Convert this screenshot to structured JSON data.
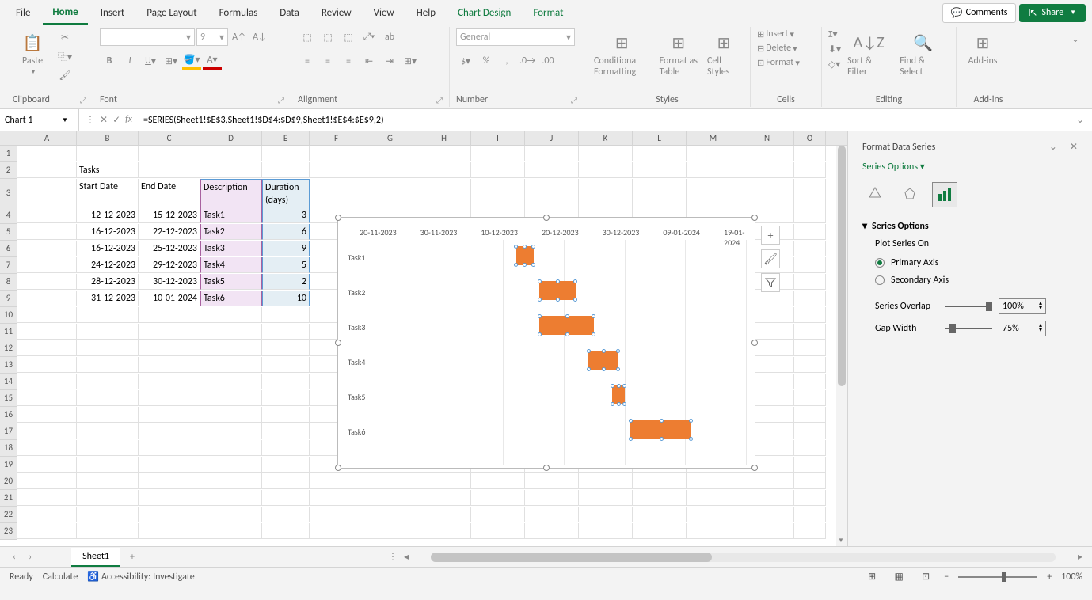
{
  "menu": {
    "items": [
      "File",
      "Home",
      "Insert",
      "Page Layout",
      "Formulas",
      "Data",
      "Review",
      "View",
      "Help",
      "Chart Design",
      "Format"
    ],
    "active": "Home",
    "comments": "Comments",
    "share": "Share"
  },
  "ribbon": {
    "clipboard": {
      "paste": "Paste",
      "label": "Clipboard"
    },
    "font": {
      "size": "9",
      "label": "Font"
    },
    "alignment": {
      "label": "Alignment"
    },
    "number": {
      "format": "General",
      "label": "Number"
    },
    "styles": {
      "conditional": "Conditional Formatting",
      "formatAs": "Format as Table",
      "cellStyles": "Cell Styles",
      "label": "Styles"
    },
    "cells": {
      "insert": "Insert",
      "delete": "Delete",
      "format": "Format",
      "label": "Cells"
    },
    "editing": {
      "sortFilter": "Sort & Filter",
      "findSelect": "Find & Select",
      "label": "Editing"
    },
    "addins": {
      "addins": "Add-ins",
      "label": "Add-ins"
    }
  },
  "nameBox": "Chart 1",
  "formula": "=SERIES(Sheet1!$E$3,Sheet1!$D$4:$D$9,Sheet1!$E$4:$E$9,2)",
  "columns": [
    "A",
    "B",
    "C",
    "D",
    "E",
    "F",
    "G",
    "H",
    "I",
    "J",
    "K",
    "L",
    "M",
    "N",
    "O"
  ],
  "spreadsheet": {
    "b2": "Tasks",
    "headers": {
      "b": "Start Date",
      "c": "End Date",
      "d": "Description",
      "e": "Duration (days)"
    },
    "rows": [
      {
        "start": "12-12-2023",
        "end": "15-12-2023",
        "desc": "Task1",
        "dur": "3"
      },
      {
        "start": "16-12-2023",
        "end": "22-12-2023",
        "desc": "Task2",
        "dur": "6"
      },
      {
        "start": "16-12-2023",
        "end": "25-12-2023",
        "desc": "Task3",
        "dur": "9"
      },
      {
        "start": "24-12-2023",
        "end": "29-12-2023",
        "desc": "Task4",
        "dur": "5"
      },
      {
        "start": "28-12-2023",
        "end": "30-12-2023",
        "desc": "Task5",
        "dur": "2"
      },
      {
        "start": "31-12-2023",
        "end": "10-01-2024",
        "desc": "Task6",
        "dur": "10"
      }
    ]
  },
  "chart_data": {
    "type": "bar",
    "title": "",
    "xlabel": "",
    "ylabel": "",
    "x_ticks": [
      "20-11-2023",
      "30-11-2023",
      "10-12-2023",
      "20-12-2023",
      "30-12-2023",
      "09-01-2024",
      "19-01-2024"
    ],
    "categories": [
      "Task1",
      "Task2",
      "Task3",
      "Task4",
      "Task5",
      "Task6"
    ],
    "series": [
      {
        "name": "Start Date",
        "values": [
          "12-12-2023",
          "16-12-2023",
          "16-12-2023",
          "24-12-2023",
          "28-12-2023",
          "31-12-2023"
        ]
      },
      {
        "name": "Duration (days)",
        "values": [
          3,
          6,
          9,
          5,
          2,
          10
        ]
      }
    ]
  },
  "panel": {
    "title": "Format Data Series",
    "subtitle": "Series Options",
    "section": "Series Options",
    "plotOn": "Plot Series On",
    "primary": "Primary Axis",
    "secondary": "Secondary Axis",
    "overlap": "Series Overlap",
    "overlapVal": "100%",
    "gapWidth": "Gap Width",
    "gapVal": "75%"
  },
  "sheetTab": "Sheet1",
  "status": {
    "ready": "Ready",
    "calculate": "Calculate",
    "accessibility": "Accessibility: Investigate",
    "zoom": "100%"
  }
}
